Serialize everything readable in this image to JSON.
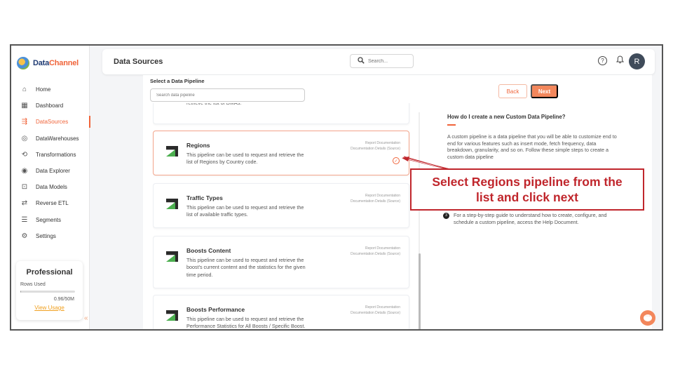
{
  "brand": {
    "name_part1": "Data",
    "name_part2": "Channel",
    "colors": {
      "accent": "#f0643a",
      "callout": "#c0262c"
    }
  },
  "sidebar": {
    "items": [
      {
        "label": "Home",
        "icon": "home-icon",
        "glyph": "⌂"
      },
      {
        "label": "Dashboard",
        "icon": "dashboard-icon",
        "glyph": "▦"
      },
      {
        "label": "DataSources",
        "icon": "datasource-icon",
        "glyph": "⇶",
        "active": true
      },
      {
        "label": "DataWarehouses",
        "icon": "database-icon",
        "glyph": "◎"
      },
      {
        "label": "Transformations",
        "icon": "transform-icon",
        "glyph": "⟲"
      },
      {
        "label": "Data Explorer",
        "icon": "explorer-icon",
        "glyph": "◉"
      },
      {
        "label": "Data Models",
        "icon": "models-icon",
        "glyph": "⊡"
      },
      {
        "label": "Reverse ETL",
        "icon": "reverse-etl-icon",
        "glyph": "⇄"
      },
      {
        "label": "Segments",
        "icon": "segments-icon",
        "glyph": "☰"
      },
      {
        "label": "Settings",
        "icon": "settings-icon",
        "glyph": "⚙"
      }
    ],
    "plan": {
      "title": "Professional",
      "rows_label": "Rows Used",
      "rows_value": "0.96/50M",
      "usage_fraction": 0.0192,
      "view_usage": "View Usage"
    },
    "collapse_glyph": "«"
  },
  "header": {
    "title": "Data Sources",
    "search_placeholder": "Search...",
    "help_glyph": "?",
    "bell_glyph": "🔔",
    "avatar_initial": "R"
  },
  "main": {
    "section_label": "Select a Data Pipeline",
    "search_placeholder": "Search data pipeline",
    "cards": [
      {
        "title": "",
        "desc": "retrieve the list of DMAs.",
        "links": []
      },
      {
        "title": "Regions",
        "desc": "This pipeline can be used to request and retrieve the list of Regions by Country code.",
        "links": [
          "Report Documentation",
          "Documentation Details (Source)"
        ],
        "selected": true
      },
      {
        "title": "Traffic Types",
        "desc": "This pipeline can be used to request and retrieve the list of available traffic types.",
        "links": [
          "Report Documentation",
          "Documentation Details (Source)"
        ]
      },
      {
        "title": "Boosts Content",
        "desc": "This pipeline can be used to request and retrieve the boost's current content and the statistics for the given time period.",
        "links": [
          "Report Documentation",
          "Documentation Details (Source)"
        ]
      },
      {
        "title": "Boosts Performance",
        "desc": "This pipeline can be used to request and retrieve the Performance Statistics for All Boosts / Specific Boost.",
        "links": [
          "Report Documentation",
          "Documentation Details (Source)"
        ]
      }
    ],
    "check_glyph": "✓"
  },
  "panel": {
    "back_label": "Back",
    "next_label": "Next",
    "help_title": "How do I create a new Custom Data Pipeline?",
    "help_body": "A custom pipeline is a data pipeline that you will be able to customize end to end for various features such as insert mode, fetch frequency, data breakdown, granularity, and so on. Follow these simple steps to create a custom data pipeline",
    "step_number": "3",
    "step_text": "For a step-by-step guide to understand how to create, configure, and schedule a custom pipeline, access the Help Document."
  },
  "callout": {
    "text": "Select Regions pipeline from the list and click next"
  },
  "chat": {
    "glyph": "···"
  }
}
